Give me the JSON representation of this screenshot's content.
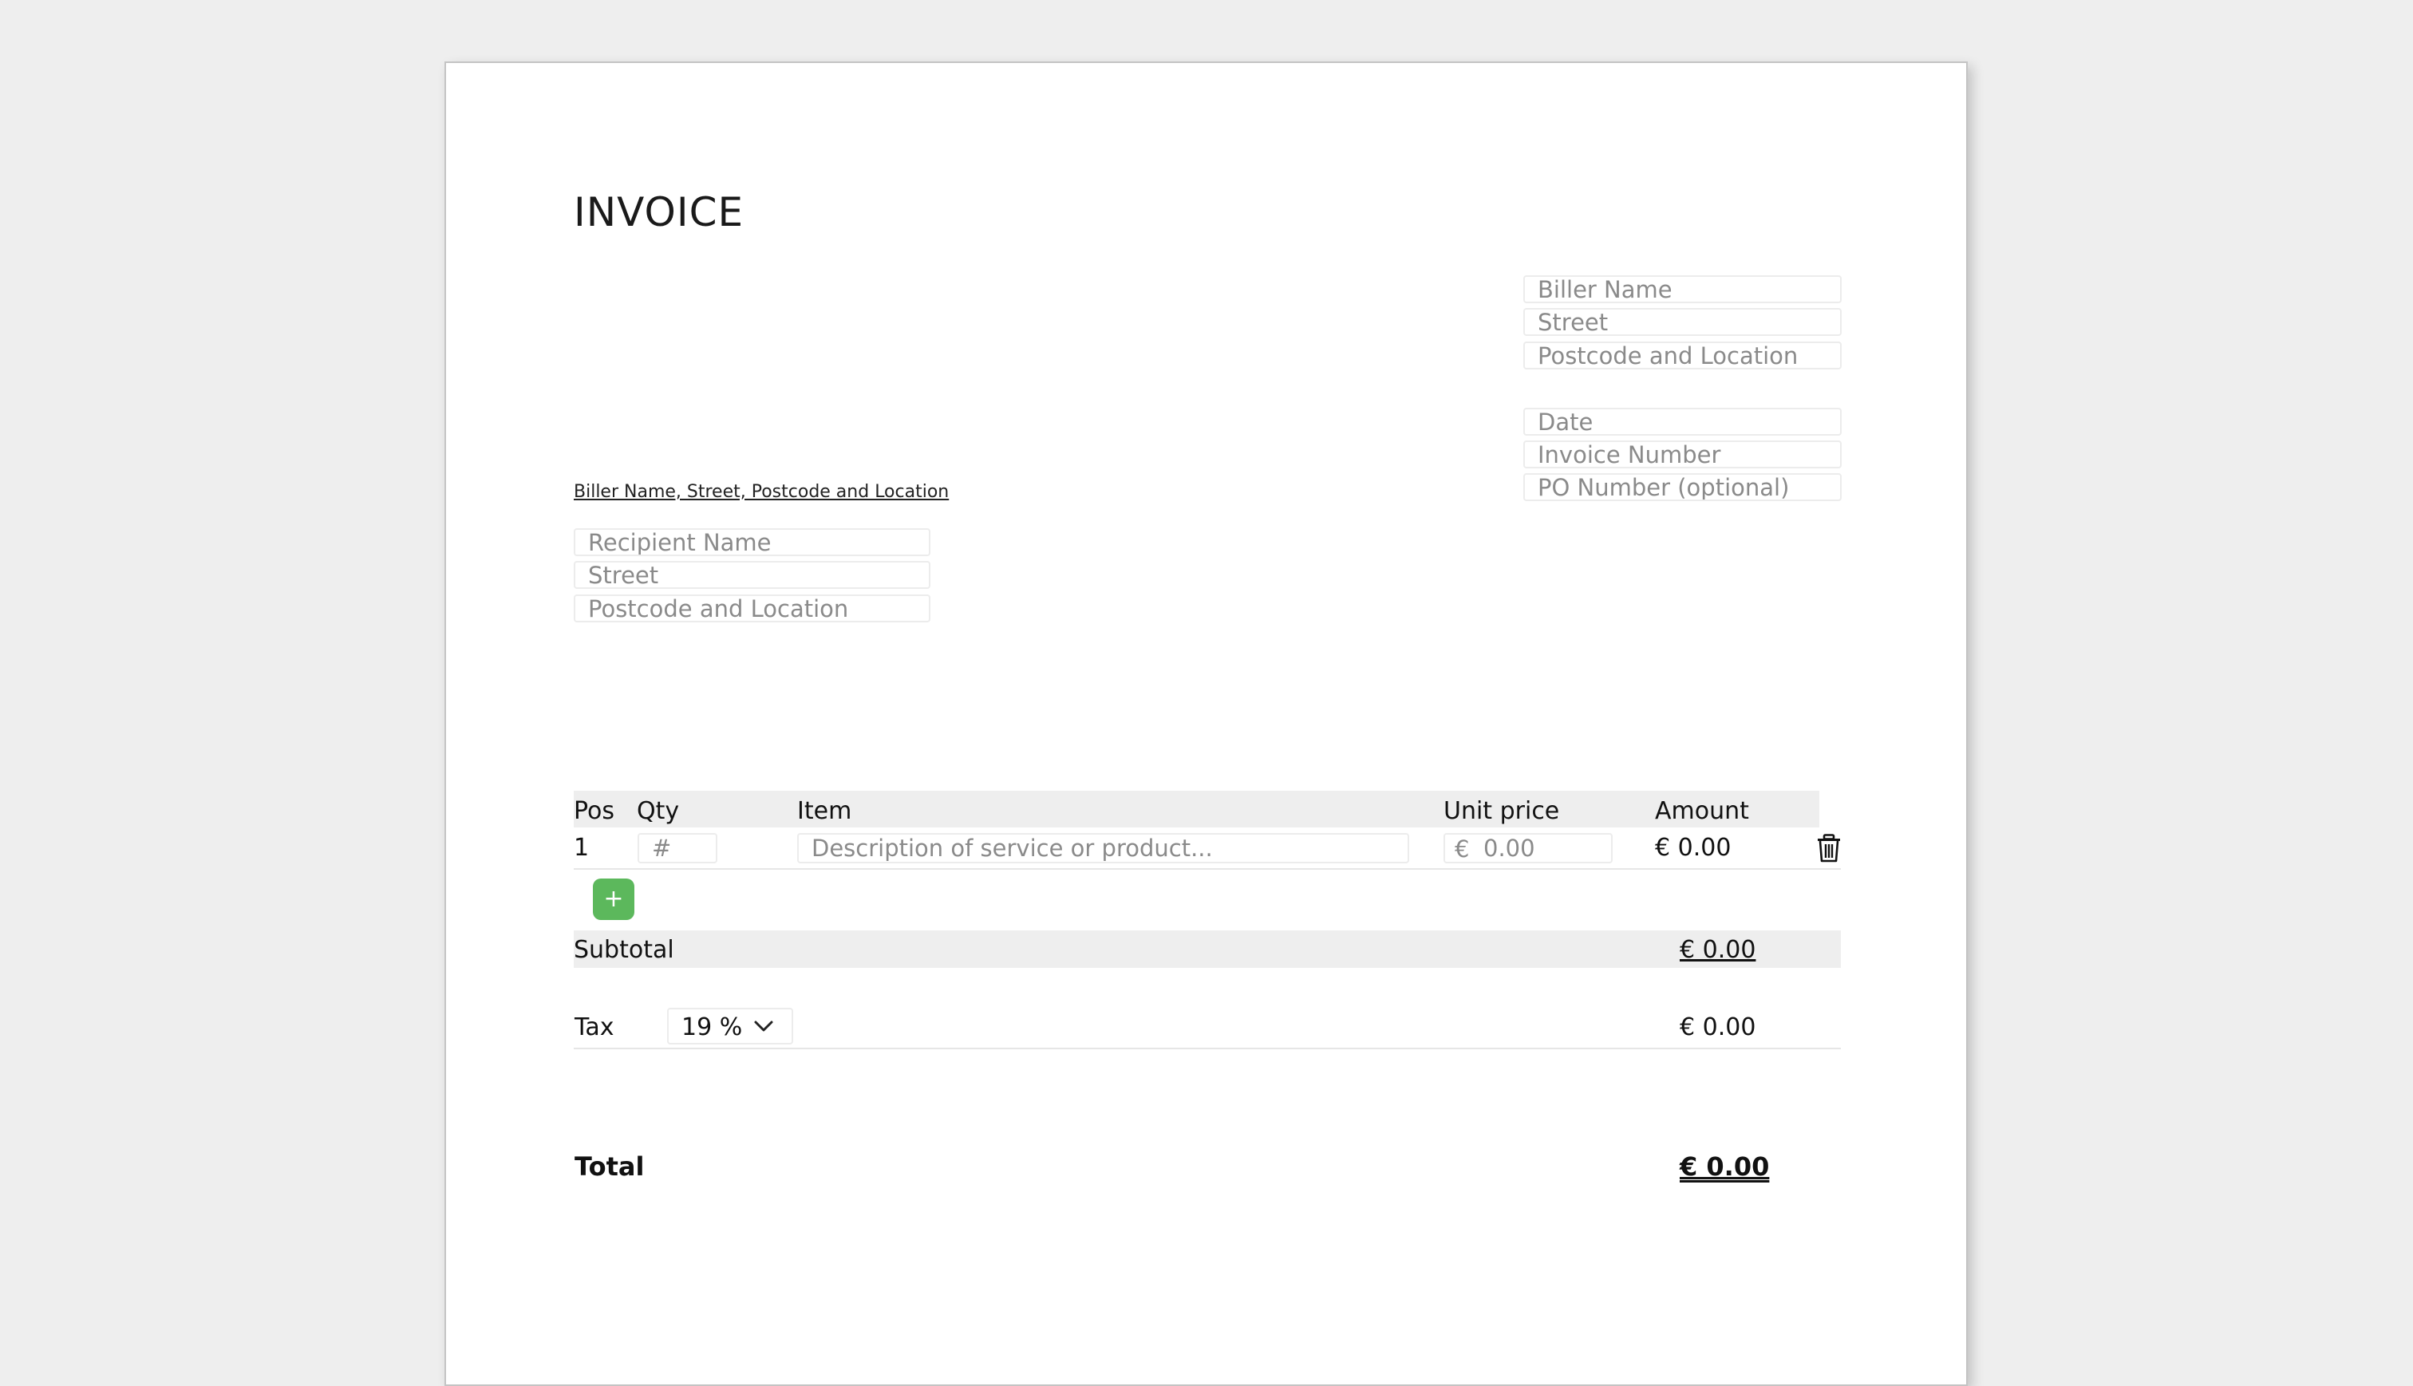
{
  "invoice": {
    "title": "INVOICE",
    "sender_line": "Biller Name, Street, Postcode and Location"
  },
  "biller": {
    "name_placeholder": "Biller Name",
    "street_placeholder": "Street",
    "location_placeholder": "Postcode and Location"
  },
  "meta": {
    "date_placeholder": "Date",
    "invoice_number_placeholder": "Invoice Number",
    "po_number_placeholder": "PO Number (optional)"
  },
  "recipient": {
    "name_placeholder": "Recipient Name",
    "street_placeholder": "Street",
    "location_placeholder": "Postcode and Location"
  },
  "table": {
    "headers": [
      "Pos",
      "Qty",
      "Item",
      "Unit price",
      "Amount"
    ],
    "rows": [
      {
        "pos": "1",
        "qty_placeholder": "#",
        "item_placeholder": "Description of service or product...",
        "unit_price_currency": "€",
        "unit_price_placeholder": "0.00",
        "amount": "€ 0.00"
      }
    ],
    "add_label": "+"
  },
  "summary": {
    "subtotal_label": "Subtotal",
    "subtotal_value": "€ 0.00",
    "tax_label": "Tax",
    "tax_rate": "19 %",
    "tax_value": "€ 0.00",
    "total_label": "Total",
    "total_value": "€ 0.00"
  },
  "icons": {
    "delete_row": "trash-icon",
    "tax_dropdown": "chevron-down-icon"
  },
  "colors": {
    "add_button": "#5cb85c",
    "header_band": "#eeeeee",
    "placeholder": "#8a8a8a"
  }
}
